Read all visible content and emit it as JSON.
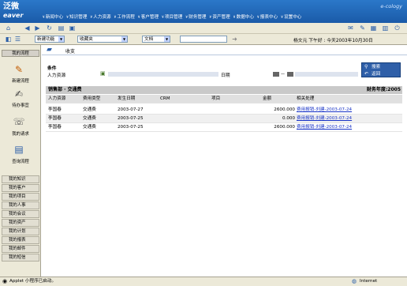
{
  "header": {
    "logo_cn": "泛微",
    "logo_en": "eaver",
    "brand_right": "e-cology",
    "nav": [
      "新闻中心",
      "知识管理",
      "人力资源",
      "工作流程",
      "客户管理",
      "项目管理",
      "财务管理",
      "资产管理",
      "数据中心",
      "报表中心",
      "设置中心"
    ]
  },
  "toolbar2": {
    "select1": "新建功能",
    "select2": "收藏夹",
    "select3": "文档",
    "user_info": "杨文元  下午好 : 今天2003年10月30日"
  },
  "sidebar": {
    "header": "我的流程",
    "items": [
      {
        "label": "新建流程",
        "icon": "new-flow-icon"
      },
      {
        "label": "待办事宜",
        "icon": "todo-icon"
      },
      {
        "label": "我的请求",
        "icon": "request-icon"
      },
      {
        "label": "查询流程",
        "icon": "query-flow-icon"
      }
    ],
    "buttons": [
      "我的知识",
      "我的客户",
      "我的项目",
      "我的人事",
      "我的会议",
      "我的资产",
      "我的计划",
      "我的报表",
      "我的邮件",
      "我的短信"
    ]
  },
  "main": {
    "title": "收支",
    "conditions_label": "条件",
    "dept_label": "人力资源",
    "date_label": "日期",
    "section_title": "销售部 · 交通费",
    "year_label": "财务年度:2005",
    "columns": [
      "人力资源",
      "费用类型",
      "发生日期",
      "CRM",
      "项目",
      "金额",
      "相关处理"
    ],
    "rows": [
      {
        "person": "李国春",
        "type": "交通费",
        "date": "2003-07-27",
        "amount": "2600.000",
        "action": "费用报销-刘建-2003-07-24"
      },
      {
        "person": "李国春",
        "type": "交通费",
        "date": "2003-07-25",
        "amount": "0.000",
        "action": "费用报销-刘建-2003-07-24"
      },
      {
        "person": "李国春",
        "type": "交通费",
        "date": "2003-07-25",
        "amount": "2600.000",
        "action": "费用报销-刘建-2003-07-24"
      }
    ]
  },
  "popup": {
    "items": [
      "搜索",
      "返回"
    ]
  },
  "status": {
    "left": "Applet 小程序已启动。",
    "right": "Internet"
  }
}
